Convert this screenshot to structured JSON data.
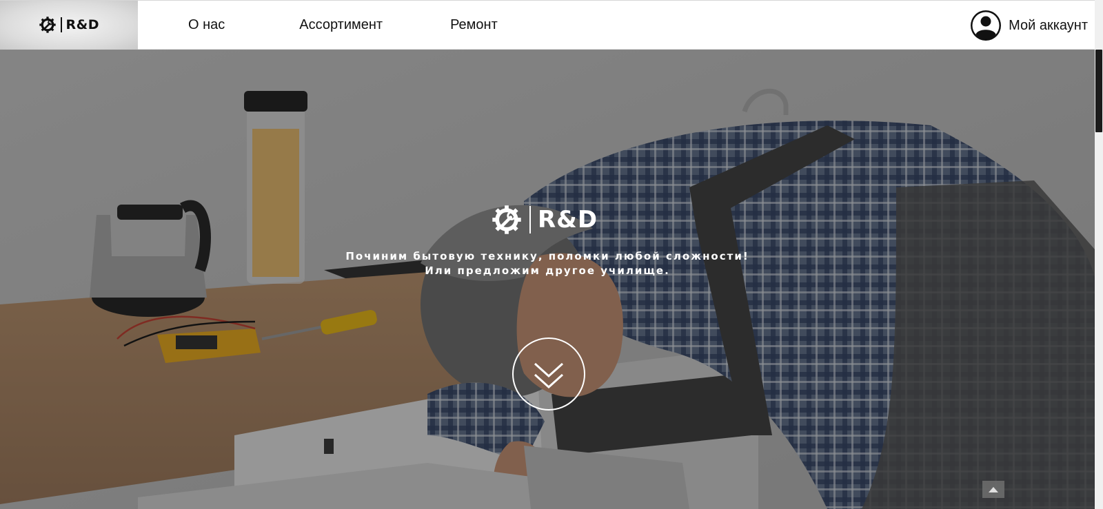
{
  "header": {
    "logo_text": "R&D",
    "nav": [
      {
        "label": "О нас"
      },
      {
        "label": "Ассортимент"
      },
      {
        "label": "Ремонт"
      }
    ],
    "account_label": "Мой аккаунт"
  },
  "hero": {
    "logo_text": "R&D",
    "tagline_line1": "Починим бытовую технику, поломки любой сложности!",
    "tagline_line2": "Или предложим другое училище."
  },
  "icons": {
    "logo": "gear-wrench-icon",
    "account": "user-circle-icon",
    "scroll_down": "double-chevron-down-icon",
    "to_top": "triangle-up-icon"
  },
  "colors": {
    "header_bg": "#ffffff",
    "text": "#111111",
    "hero_text": "#ffffff",
    "scroll_thumb": "#1b1b1b"
  }
}
